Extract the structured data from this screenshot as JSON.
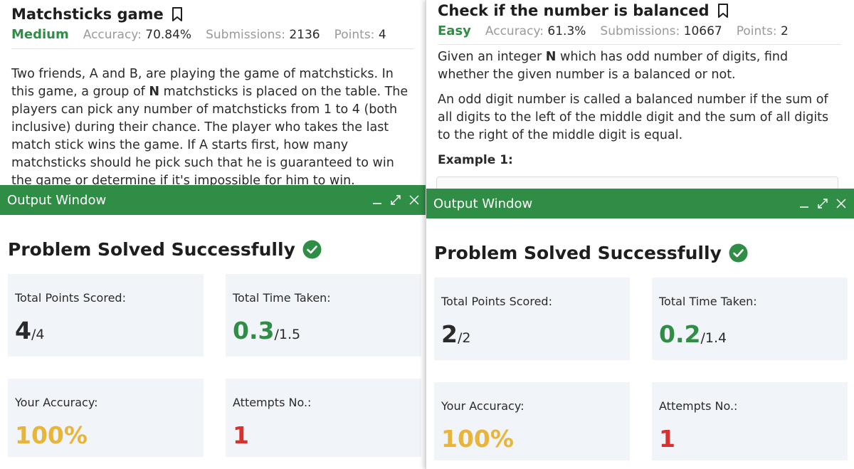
{
  "colors": {
    "brand_green": "#2f8d46",
    "accuracy_yellow": "#e8b53a",
    "attempts_red": "#d8322e",
    "card_bg": "#f1f4f9"
  },
  "icons": {
    "bookmark": "bookmark-icon",
    "minimize": "minimize-icon",
    "expand": "expand-icon",
    "close": "close-icon",
    "check": "check-circle-icon"
  },
  "left": {
    "title": "Matchsticks game",
    "difficulty": "Medium",
    "accuracy_label": "Accuracy:",
    "accuracy_value": "70.84%",
    "submissions_label": "Submissions:",
    "submissions_value": "2136",
    "points_label": "Points:",
    "points_value": "4",
    "description": {
      "part1": "Two friends, A and B, are playing the game of matchsticks. In this game, a group of ",
      "bold": "N",
      "part2": " matchsticks is placed on the table. The players can pick any number of matchsticks from 1 to 4 (both inclusive) during their chance. The player who takes the last match stick wins the game. If A starts first, how many matchsticks should he pick such that he is guaranteed to win the game or determine if it's impossible for him to win."
    },
    "output": {
      "window_title": "Output Window",
      "solved_text": "Problem Solved Successfully",
      "points_label": "Total Points Scored:",
      "points_scored": "4",
      "points_total": "/4",
      "time_label": "Total Time Taken:",
      "time_taken": "0.3",
      "time_total": "/1.5",
      "accuracy_label": "Your Accuracy:",
      "accuracy_value": "100%",
      "attempts_label": "Attempts No.:",
      "attempts_value": "1"
    }
  },
  "right": {
    "title": "Check if the number is balanced",
    "difficulty": "Easy",
    "accuracy_label": "Accuracy:",
    "accuracy_value": "61.3%",
    "submissions_label": "Submissions:",
    "submissions_value": "10667",
    "points_label": "Points:",
    "points_value": "2",
    "description": {
      "p1_part1": "Given an integer ",
      "p1_bold": "N",
      "p1_part2": " which has odd number of digits, find whether the given number is a balanced or not.",
      "p2": "An odd digit number is called a balanced number if the sum of all digits to the left of the middle digit and the sum of all digits to the right of the middle digit is equal.",
      "example_label": "Example 1:"
    },
    "output": {
      "window_title": "Output Window",
      "solved_text": "Problem Solved Successfully",
      "points_label": "Total Points Scored:",
      "points_scored": "2",
      "points_total": "/2",
      "time_label": "Total Time Taken:",
      "time_taken": "0.2",
      "time_total": "/1.4",
      "accuracy_label": "Your Accuracy:",
      "accuracy_value": "100%",
      "attempts_label": "Attempts No.:",
      "attempts_value": "1"
    }
  }
}
